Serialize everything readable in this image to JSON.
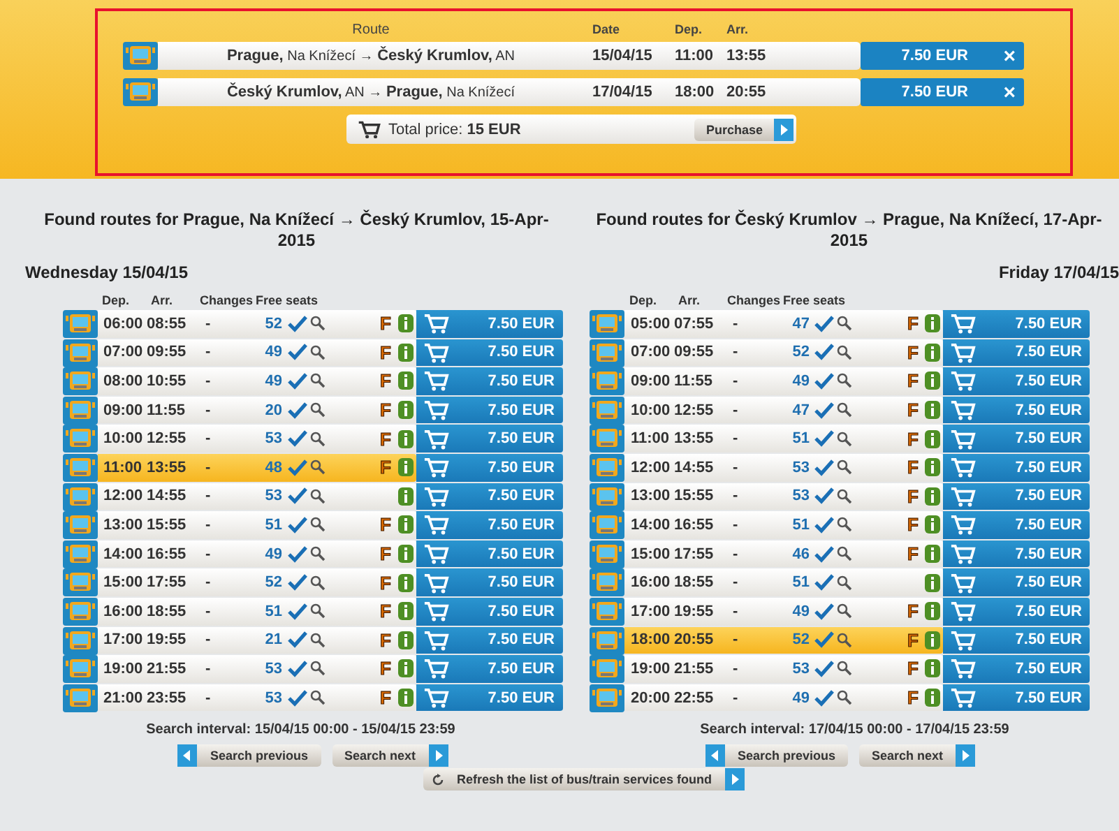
{
  "cart": {
    "columns": [
      "Route",
      "Date",
      "Dep.",
      "Arr."
    ],
    "items": [
      {
        "route": "**Prague,** Na Knížecí → **Český Krumlov,** AN",
        "date": "15/04/15",
        "dep": "11:00",
        "arr": "13:55",
        "price": "7.50 EUR",
        "remove": "×"
      },
      {
        "route": "**Český Krumlov,** AN → **Prague,** Na Knížecí",
        "date": "17/04/15",
        "dep": "18:00",
        "arr": "20:55",
        "price": "7.50 EUR",
        "remove": "×"
      }
    ],
    "total": "Total price: **15 EUR**",
    "purchase": "Purchase"
  },
  "sections": [
    {
      "title": "Found routes for Prague, Na Knížecí → Český Krumlov, 15-Apr-2015",
      "day": "Wednesday 15/04/15",
      "columns": [
        "Dep.",
        "Arr.",
        "Changes",
        "Free seats"
      ],
      "rows": [
        {
          "dep": "06:00",
          "arr": "08:55",
          "changes": "-",
          "seats": "52",
          "badge": "F",
          "price": "7.50 EUR",
          "selected": false
        },
        {
          "dep": "07:00",
          "arr": "09:55",
          "changes": "-",
          "seats": "49",
          "badge": "F",
          "price": "7.50 EUR",
          "selected": false
        },
        {
          "dep": "08:00",
          "arr": "10:55",
          "changes": "-",
          "seats": "49",
          "badge": "F",
          "price": "7.50 EUR",
          "selected": false
        },
        {
          "dep": "09:00",
          "arr": "11:55",
          "changes": "-",
          "seats": "20",
          "badge": "F",
          "price": "7.50 EUR",
          "selected": false
        },
        {
          "dep": "10:00",
          "arr": "12:55",
          "changes": "-",
          "seats": "53",
          "badge": "F",
          "price": "7.50 EUR",
          "selected": false
        },
        {
          "dep": "11:00",
          "arr": "13:55",
          "changes": "-",
          "seats": "48",
          "badge": "F",
          "price": "7.50 EUR",
          "selected": true
        },
        {
          "dep": "12:00",
          "arr": "14:55",
          "changes": "-",
          "seats": "53",
          "price": "7.50 EUR",
          "selected": false
        },
        {
          "dep": "13:00",
          "arr": "15:55",
          "changes": "-",
          "seats": "51",
          "badge": "F",
          "price": "7.50 EUR",
          "selected": false
        },
        {
          "dep": "14:00",
          "arr": "16:55",
          "changes": "-",
          "seats": "49",
          "badge": "F",
          "price": "7.50 EUR",
          "selected": false
        },
        {
          "dep": "15:00",
          "arr": "17:55",
          "changes": "-",
          "seats": "52",
          "badge": "F",
          "price": "7.50 EUR",
          "selected": false
        },
        {
          "dep": "16:00",
          "arr": "18:55",
          "changes": "-",
          "seats": "51",
          "badge": "F",
          "price": "7.50 EUR",
          "selected": false
        },
        {
          "dep": "17:00",
          "arr": "19:55",
          "changes": "-",
          "seats": "21",
          "badge": "F",
          "price": "7.50 EUR",
          "selected": false
        },
        {
          "dep": "19:00",
          "arr": "21:55",
          "changes": "-",
          "seats": "53",
          "badge": "F",
          "price": "7.50 EUR",
          "selected": false
        },
        {
          "dep": "21:00",
          "arr": "23:55",
          "changes": "-",
          "seats": "53",
          "badge": "F",
          "price": "7.50 EUR",
          "selected": false
        }
      ],
      "interval": "Search interval: 15/04/15 00:00 - 15/04/15 23:59",
      "previous": "Search previous",
      "next": "Search next"
    },
    {
      "title": "Found routes for Český Krumlov → Prague, Na Knížecí, 17-Apr-2015",
      "day": "Friday 17/04/15",
      "columns": [
        "Dep.",
        "Arr.",
        "Changes",
        "Free seats"
      ],
      "rows": [
        {
          "dep": "05:00",
          "arr": "07:55",
          "changes": "-",
          "seats": "47",
          "badge": "F",
          "price": "7.50 EUR",
          "selected": false
        },
        {
          "dep": "07:00",
          "arr": "09:55",
          "changes": "-",
          "seats": "52",
          "badge": "F",
          "price": "7.50 EUR",
          "selected": false
        },
        {
          "dep": "09:00",
          "arr": "11:55",
          "changes": "-",
          "seats": "49",
          "badge": "F",
          "price": "7.50 EUR",
          "selected": false
        },
        {
          "dep": "10:00",
          "arr": "12:55",
          "changes": "-",
          "seats": "47",
          "badge": "F",
          "price": "7.50 EUR",
          "selected": false
        },
        {
          "dep": "11:00",
          "arr": "13:55",
          "changes": "-",
          "seats": "51",
          "badge": "F",
          "price": "7.50 EUR",
          "selected": false
        },
        {
          "dep": "12:00",
          "arr": "14:55",
          "changes": "-",
          "seats": "53",
          "badge": "F",
          "price": "7.50 EUR",
          "selected": false
        },
        {
          "dep": "13:00",
          "arr": "15:55",
          "changes": "-",
          "seats": "53",
          "badge": "F",
          "price": "7.50 EUR",
          "selected": false
        },
        {
          "dep": "14:00",
          "arr": "16:55",
          "changes": "-",
          "seats": "51",
          "badge": "F",
          "price": "7.50 EUR",
          "selected": false
        },
        {
          "dep": "15:00",
          "arr": "17:55",
          "changes": "-",
          "seats": "46",
          "badge": "F",
          "price": "7.50 EUR",
          "selected": false
        },
        {
          "dep": "16:00",
          "arr": "18:55",
          "changes": "-",
          "seats": "51",
          "price": "7.50 EUR",
          "selected": false
        },
        {
          "dep": "17:00",
          "arr": "19:55",
          "changes": "-",
          "seats": "49",
          "badge": "F",
          "price": "7.50 EUR",
          "selected": false
        },
        {
          "dep": "18:00",
          "arr": "20:55",
          "changes": "-",
          "seats": "52",
          "badge": "F",
          "price": "7.50 EUR",
          "selected": true
        },
        {
          "dep": "19:00",
          "arr": "21:55",
          "changes": "-",
          "seats": "53",
          "badge": "F",
          "price": "7.50 EUR",
          "selected": false
        },
        {
          "dep": "20:00",
          "arr": "22:55",
          "changes": "-",
          "seats": "49",
          "badge": "F",
          "price": "7.50 EUR",
          "selected": false
        }
      ],
      "interval": "Search interval: 17/04/15 00:00 - 17/04/15 23:59",
      "previous": "Search previous",
      "next": "Search next"
    }
  ],
  "refresh": "Refresh the list of bus/train services found"
}
